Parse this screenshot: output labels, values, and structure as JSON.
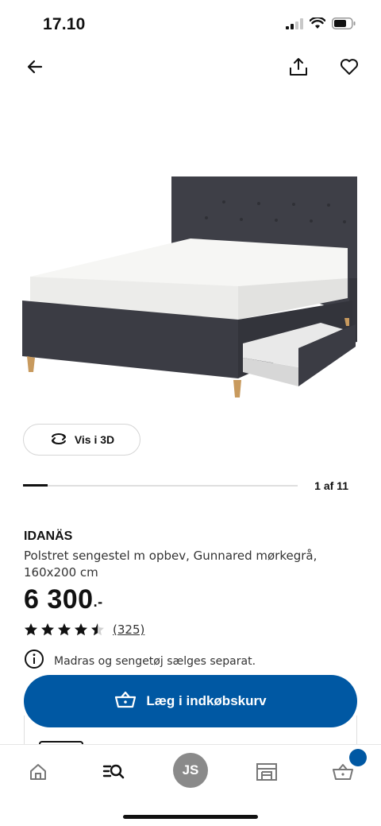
{
  "status_bar": {
    "time": "17.10",
    "battery_level": 0.7
  },
  "top_nav": {
    "icons": [
      "back-arrow-icon",
      "share-icon",
      "heart-icon"
    ]
  },
  "product": {
    "image": "bed-icon",
    "name": "IDANÄS",
    "description": "Polstret sengestel m opbev, Gunnared mørkegrå, 160x200 cm",
    "price": "6 300",
    "price_suffix": ".-",
    "rating": 4.5,
    "rating_max": 5,
    "review_count": "(325)",
    "notice": "Madras og sengetøj sælges separat."
  },
  "gallery": {
    "view_3d_label": "Vis i 3D",
    "position_label": "1 af 11",
    "current": 1,
    "total": 11
  },
  "cta": {
    "add_to_cart_label": "Læg i indkøbskurv"
  },
  "bottom_nav": {
    "items": [
      "home-icon",
      "search-list-icon",
      "profile-avatar",
      "store-icon",
      "cart-icon"
    ],
    "avatar_initials": "JS"
  },
  "colors": {
    "brand_blue": "#0058a3",
    "text": "#111111",
    "avatar_gray": "#8a8a8a",
    "bed_fabric": "#3e3f47"
  }
}
